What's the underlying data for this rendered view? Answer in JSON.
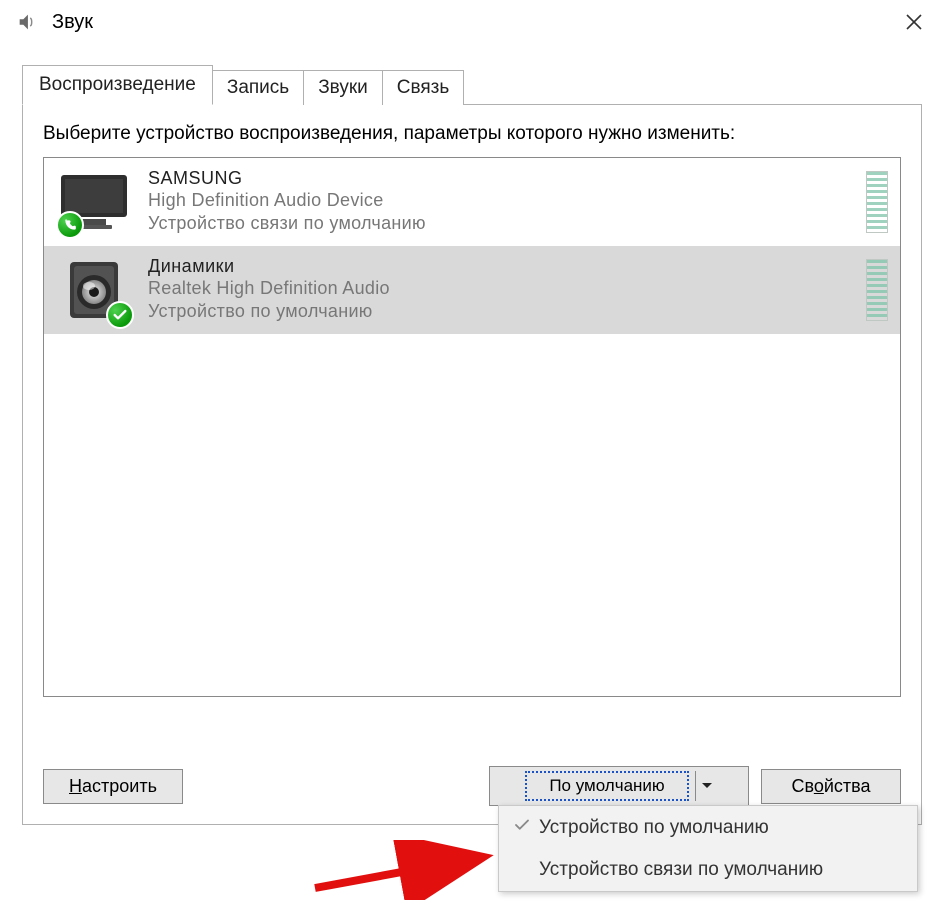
{
  "window": {
    "title": "Звук"
  },
  "tabs": [
    {
      "label": "Воспроизведение",
      "active": true
    },
    {
      "label": "Запись",
      "active": false
    },
    {
      "label": "Звуки",
      "active": false
    },
    {
      "label": "Связь",
      "active": false
    }
  ],
  "description": "Выберите устройство воспроизведения, параметры которого нужно изменить:",
  "devices": [
    {
      "name": "SAMSUNG",
      "driver": "High Definition Audio Device",
      "status": "Устройство связи по умолчанию",
      "icon": "monitor",
      "badge": "phone",
      "selected": false
    },
    {
      "name": "Динамики",
      "driver": "Realtek High Definition Audio",
      "status": "Устройство по умолчанию",
      "icon": "speaker",
      "badge": "check",
      "selected": true
    }
  ],
  "buttons": {
    "configure": "Настроить",
    "configure_ul": "Н",
    "configure_rest": "астроить",
    "default": "По умолчанию",
    "default_ul": "ч",
    "default_pre": "По умол",
    "default_post": "анию",
    "properties": "Свойства",
    "properties_ul": "о",
    "properties_pre": "Св",
    "properties_post": "йства"
  },
  "menu": {
    "items": [
      {
        "label": "Устройство по умолчанию",
        "checked": true
      },
      {
        "label": "Устройство связи по умолчанию",
        "checked": false
      }
    ]
  }
}
